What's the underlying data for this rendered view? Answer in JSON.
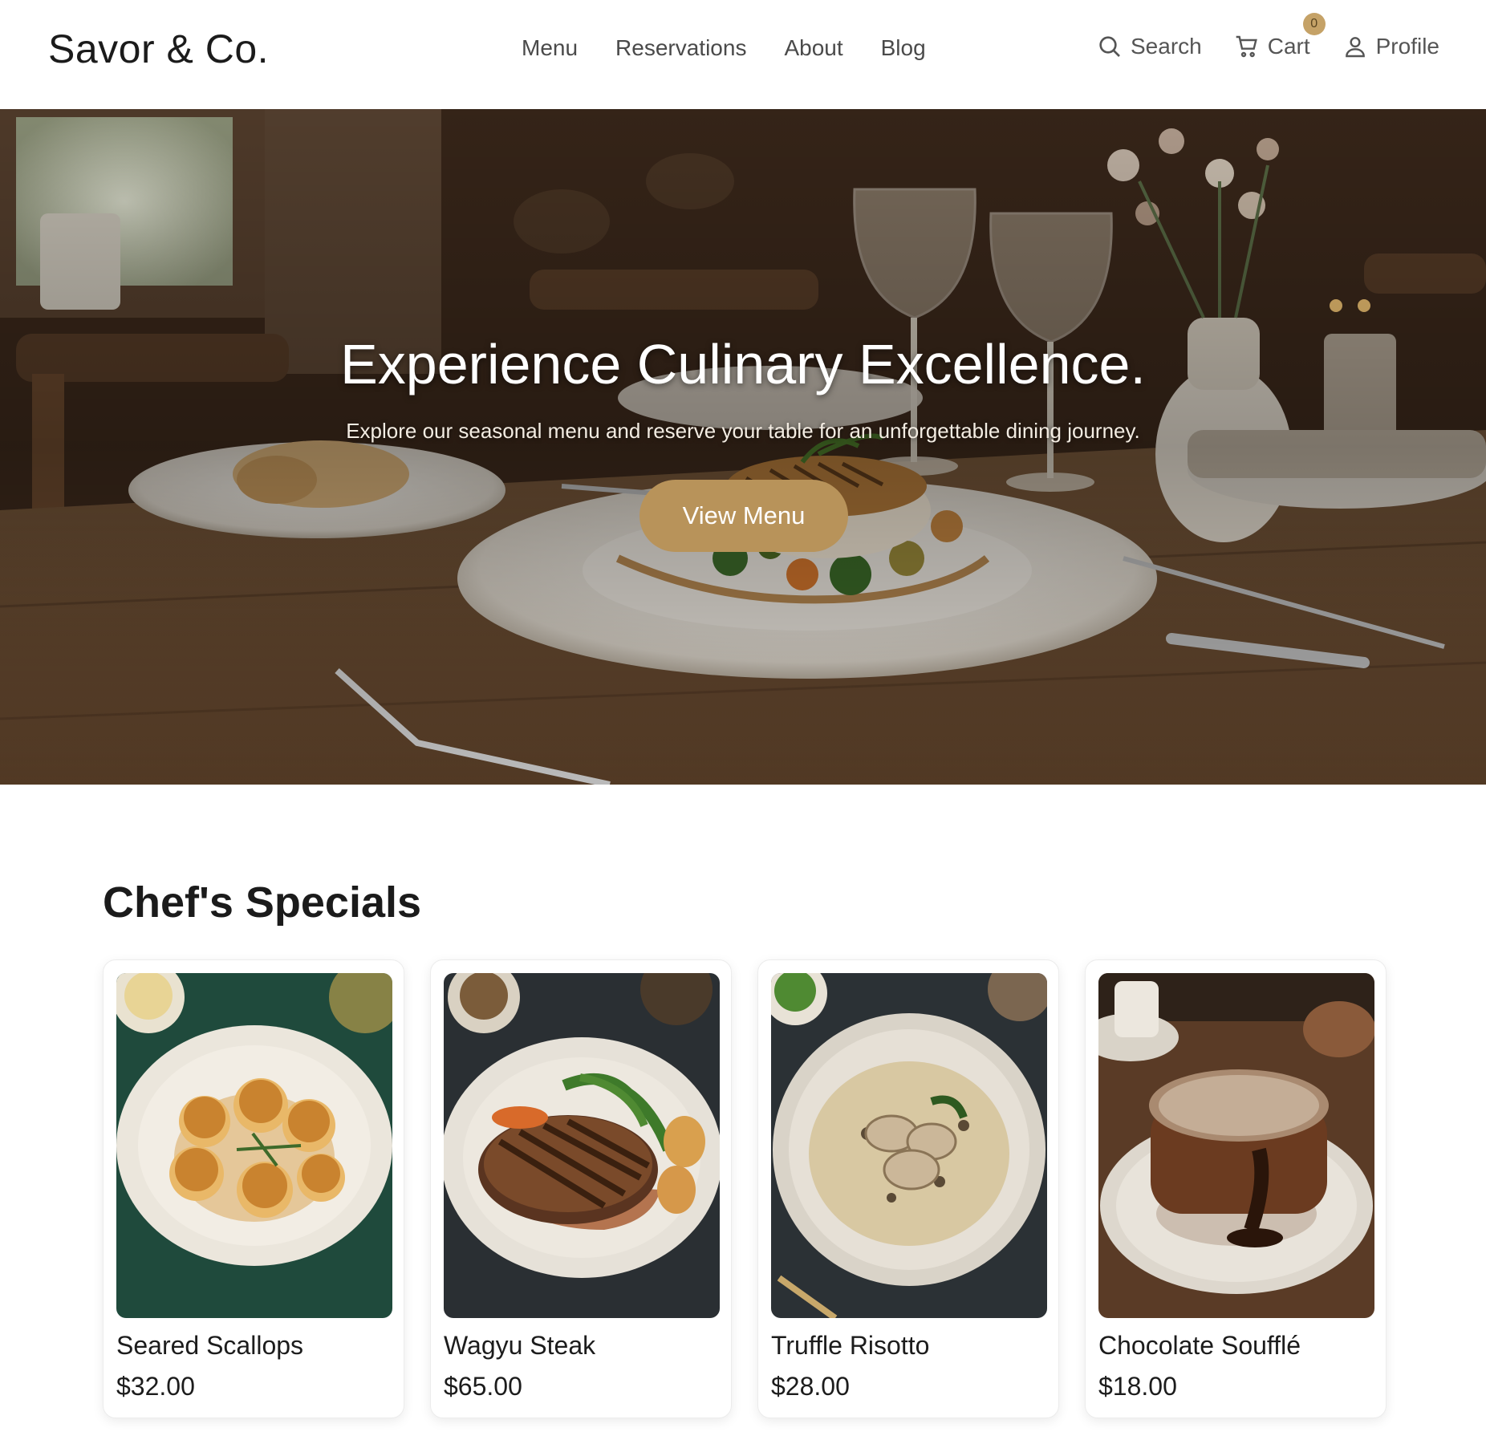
{
  "header": {
    "logo": "Savor & Co.",
    "nav": [
      "Menu",
      "Reservations",
      "About",
      "Blog"
    ],
    "search_label": "Search",
    "cart_label": "Cart",
    "cart_count": "0",
    "profile_label": "Profile"
  },
  "hero": {
    "title": "Experience Culinary Excellence.",
    "subtitle": "Explore our seasonal menu and reserve your table for an unforgettable dining journey.",
    "button_label": "View Menu"
  },
  "specials": {
    "title": "Chef's Specials",
    "items": [
      {
        "name": "Seared Scallops",
        "price": "$32.00"
      },
      {
        "name": "Wagyu Steak",
        "price": "$65.00"
      },
      {
        "name": "Truffle Risotto",
        "price": "$28.00"
      },
      {
        "name": "Chocolate Soufflé",
        "price": "$18.00"
      }
    ]
  },
  "colors": {
    "accent": "#b8935a",
    "badge": "#c5a267",
    "text": "#1b1b1b",
    "nav_text": "#4a4a4a"
  },
  "icons": [
    "search-icon",
    "cart-icon",
    "user-icon"
  ]
}
